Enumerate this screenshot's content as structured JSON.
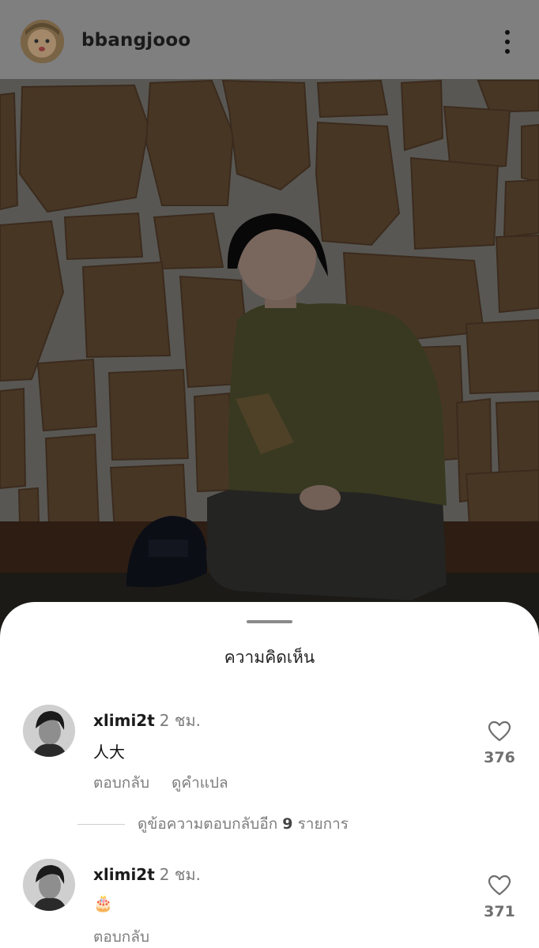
{
  "post": {
    "username": "bbangjooo",
    "photo_alt": "photo",
    "more_icon": "vertical-ellipsis-icon"
  },
  "sheet": {
    "title": "ความคิดเห็น"
  },
  "comments": [
    {
      "username": "xlimi2t",
      "time": "2 ชม.",
      "text": "人大",
      "actions": [
        "ตอบกลับ",
        "ดูคำแปล"
      ],
      "likes": "376"
    },
    {
      "username": "xlimi2t",
      "time": "2 ชม.",
      "text": "🎂",
      "actions": [
        "ตอบกลับ"
      ],
      "likes": "371"
    }
  ],
  "more_replies": {
    "prefix": "ดูข้อความตอบกลับอีก",
    "count": "9",
    "suffix": "รายการ"
  },
  "colors": {
    "header_overlay": "#7f7f7f",
    "sheet_bg": "#ffffff",
    "secondary_text": "#7d7d7d"
  }
}
